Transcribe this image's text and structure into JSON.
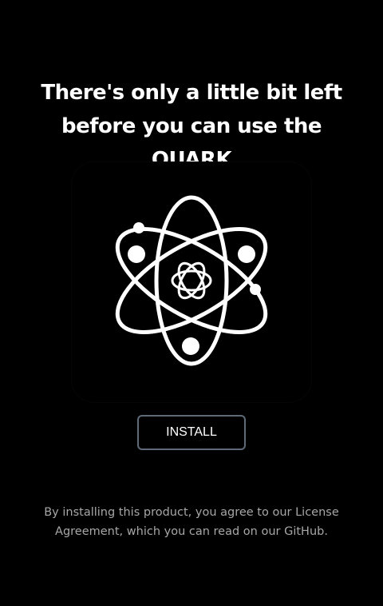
{
  "headline": {
    "line1": "There's only a little bit left",
    "line2": "before you can use the",
    "line3": "QUARK"
  },
  "logo": {
    "icon": "atom-icon",
    "stroke_color": "#ffffff"
  },
  "install_button": {
    "label": "INSTALL",
    "border_color": "#5f6a78"
  },
  "disclaimer": {
    "line1": "By installing this product, you agree to our License",
    "line2": "Agreement, which you can read on our GitHub."
  },
  "colors": {
    "background": "#000000",
    "text": "#ffffff",
    "muted_text": "#a7a7a7"
  }
}
